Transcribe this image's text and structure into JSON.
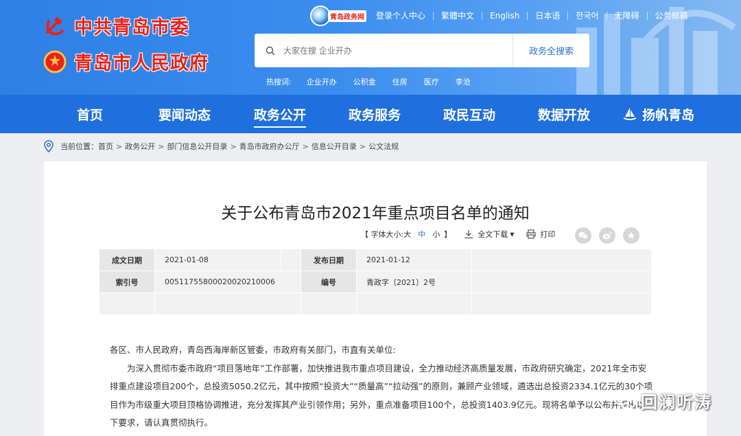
{
  "header": {
    "party_name": "中共青岛市委",
    "gov_name": "青岛市人民政府",
    "site_logo_text": "青岛政务网",
    "top_links": [
      "登录个人中心",
      "繁體中文",
      "English",
      "日本语",
      "한국어",
      "无障碍",
      "公务邮箱"
    ],
    "search": {
      "placeholder": "大家在搜 企业开办",
      "button": "政务全搜索"
    },
    "hot_label": "热搜词:",
    "hot_words": [
      "企业开办",
      "公积金",
      "住房",
      "医疗",
      "李沧"
    ]
  },
  "nav": {
    "items": [
      "首页",
      "要闻动态",
      "政务公开",
      "政务服务",
      "政民互动",
      "数据开放",
      "扬帆青岛"
    ],
    "active_index": 2
  },
  "breadcrumb": {
    "label": "当前位置：",
    "items": [
      "首页",
      "政务公开",
      "部门信息公开目录",
      "青岛市政府办公厅",
      "信息公开目录",
      "公文法规"
    ],
    "sep": ">"
  },
  "document": {
    "title": "关于公布青岛市2021年重点项目名单的通知",
    "toolbar": {
      "font_open": "【 字体大小:",
      "sizes": [
        "大",
        "中",
        "小"
      ],
      "font_close": "】",
      "download": "全文下载",
      "print": "打印"
    },
    "meta": {
      "created_label": "成文日期",
      "created": "2021-01-08",
      "published_label": "发布日期",
      "published": "2021-01-12",
      "index_label": "索引号",
      "index": "00511755800020020210006",
      "number_label": "编号",
      "number": "青政字〔2021〕2号"
    },
    "body": [
      "各区、市人民政府，青岛西海岸新区管委，市政府有关部门，市直有关单位:",
      "为深入贯彻市委市政府“项目落地年”工作部署，加快推进我市重点项目建设，全力推动经济高质量发展，市政府研究确定，2021年全市安排重点建设项目200个，总投资5050.2亿元，其中按照“投资大”“质量高”“拉动强”的原则，兼顾产业领域，遴选出总投资2334.1亿元的30个项目作为市级重大项目顶格协调推进，充分发挥其产业引领作用；另外，重点准备项目100个，总投资1403.9亿元。现将名单予以公布并提出以下要求，请认真贯彻执行。"
    ]
  },
  "watermark": {
    "name": "回澜听涛"
  },
  "colors": {
    "header_blue": "#3b8dee",
    "nav_blue": "#1f6fde",
    "logo_red": "#e8231a"
  }
}
